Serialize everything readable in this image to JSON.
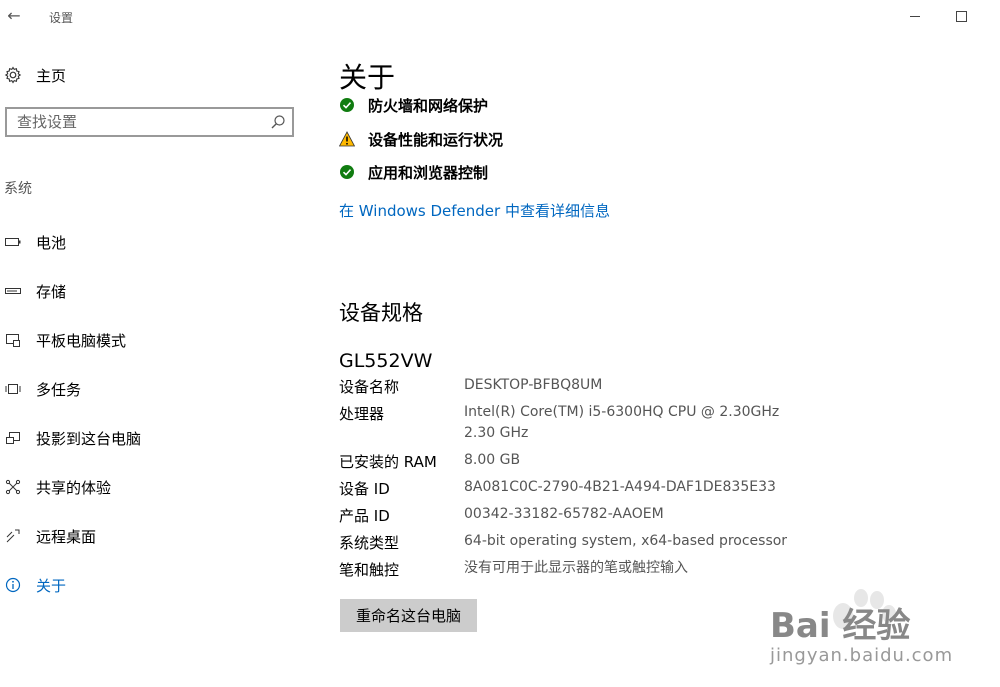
{
  "window": {
    "title": "设置"
  },
  "sidebar": {
    "home_label": "主页",
    "search_placeholder": "查找设置",
    "section_label": "系统",
    "items": [
      {
        "label": "电池",
        "icon": "battery-icon"
      },
      {
        "label": "存储",
        "icon": "storage-icon"
      },
      {
        "label": "平板电脑模式",
        "icon": "tablet-mode-icon"
      },
      {
        "label": "多任务",
        "icon": "multitasking-icon"
      },
      {
        "label": "投影到这台电脑",
        "icon": "project-icon"
      },
      {
        "label": "共享的体验",
        "icon": "shared-experiences-icon"
      },
      {
        "label": "远程桌面",
        "icon": "remote-desktop-icon"
      },
      {
        "label": "关于",
        "icon": "info-icon",
        "active": true
      }
    ]
  },
  "main": {
    "title": "关于",
    "status": [
      {
        "label": "防火墙和网络保护",
        "state": "ok"
      },
      {
        "label": "设备性能和运行状况",
        "state": "warning"
      },
      {
        "label": "应用和浏览器控制",
        "state": "ok"
      }
    ],
    "defender_link": "在 Windows Defender 中查看详细信息",
    "specs_title": "设备规格",
    "device_model": "GL552VW",
    "specs": [
      {
        "label": "设备名称",
        "value": "DESKTOP-BFBQ8UM"
      },
      {
        "label": "处理器",
        "value": "Intel(R) Core(TM) i5-6300HQ CPU @ 2.30GHz",
        "value2": "2.30 GHz"
      },
      {
        "label": "已安装的 RAM",
        "value": "8.00 GB"
      },
      {
        "label": "设备 ID",
        "value": "8A081C0C-2790-4B21-A494-DAF1DE835E33"
      },
      {
        "label": "产品 ID",
        "value": "00342-33182-65782-AAOEM"
      },
      {
        "label": "系统类型",
        "value": "64-bit operating system, x64-based processor"
      },
      {
        "label": "笔和触控",
        "value": "没有可用于此显示器的笔或触控输入"
      }
    ],
    "rename_button": "重命名这台电脑"
  },
  "watermark": {
    "text": "Bai 经验",
    "url": "jingyan.baidu.com"
  },
  "colors": {
    "accent": "#0067c0",
    "ok": "#107c10",
    "warning": "#ffb900"
  }
}
